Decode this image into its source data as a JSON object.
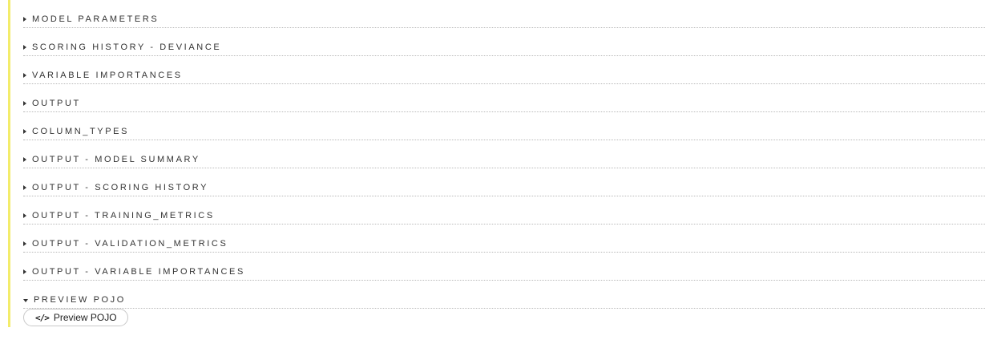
{
  "sections": [
    {
      "label": "MODEL PARAMETERS",
      "expanded": false
    },
    {
      "label": "SCORING HISTORY - DEVIANCE",
      "expanded": false
    },
    {
      "label": "VARIABLE IMPORTANCES",
      "expanded": false
    },
    {
      "label": "OUTPUT",
      "expanded": false
    },
    {
      "label": "COLUMN_TYPES",
      "expanded": false
    },
    {
      "label": "OUTPUT - MODEL SUMMARY",
      "expanded": false
    },
    {
      "label": "OUTPUT - SCORING HISTORY",
      "expanded": false
    },
    {
      "label": "OUTPUT - TRAINING_METRICS",
      "expanded": false
    },
    {
      "label": "OUTPUT - VALIDATION_METRICS",
      "expanded": false
    },
    {
      "label": "OUTPUT - VARIABLE IMPORTANCES",
      "expanded": false
    },
    {
      "label": "PREVIEW POJO",
      "expanded": true
    }
  ],
  "preview_pojo_button": {
    "icon": "code-icon",
    "icon_glyph": "</>",
    "label": "Preview POJO"
  },
  "colors": {
    "accent_bar": "#f3ec6b",
    "text": "#333333",
    "divider": "#b9b9b9"
  }
}
